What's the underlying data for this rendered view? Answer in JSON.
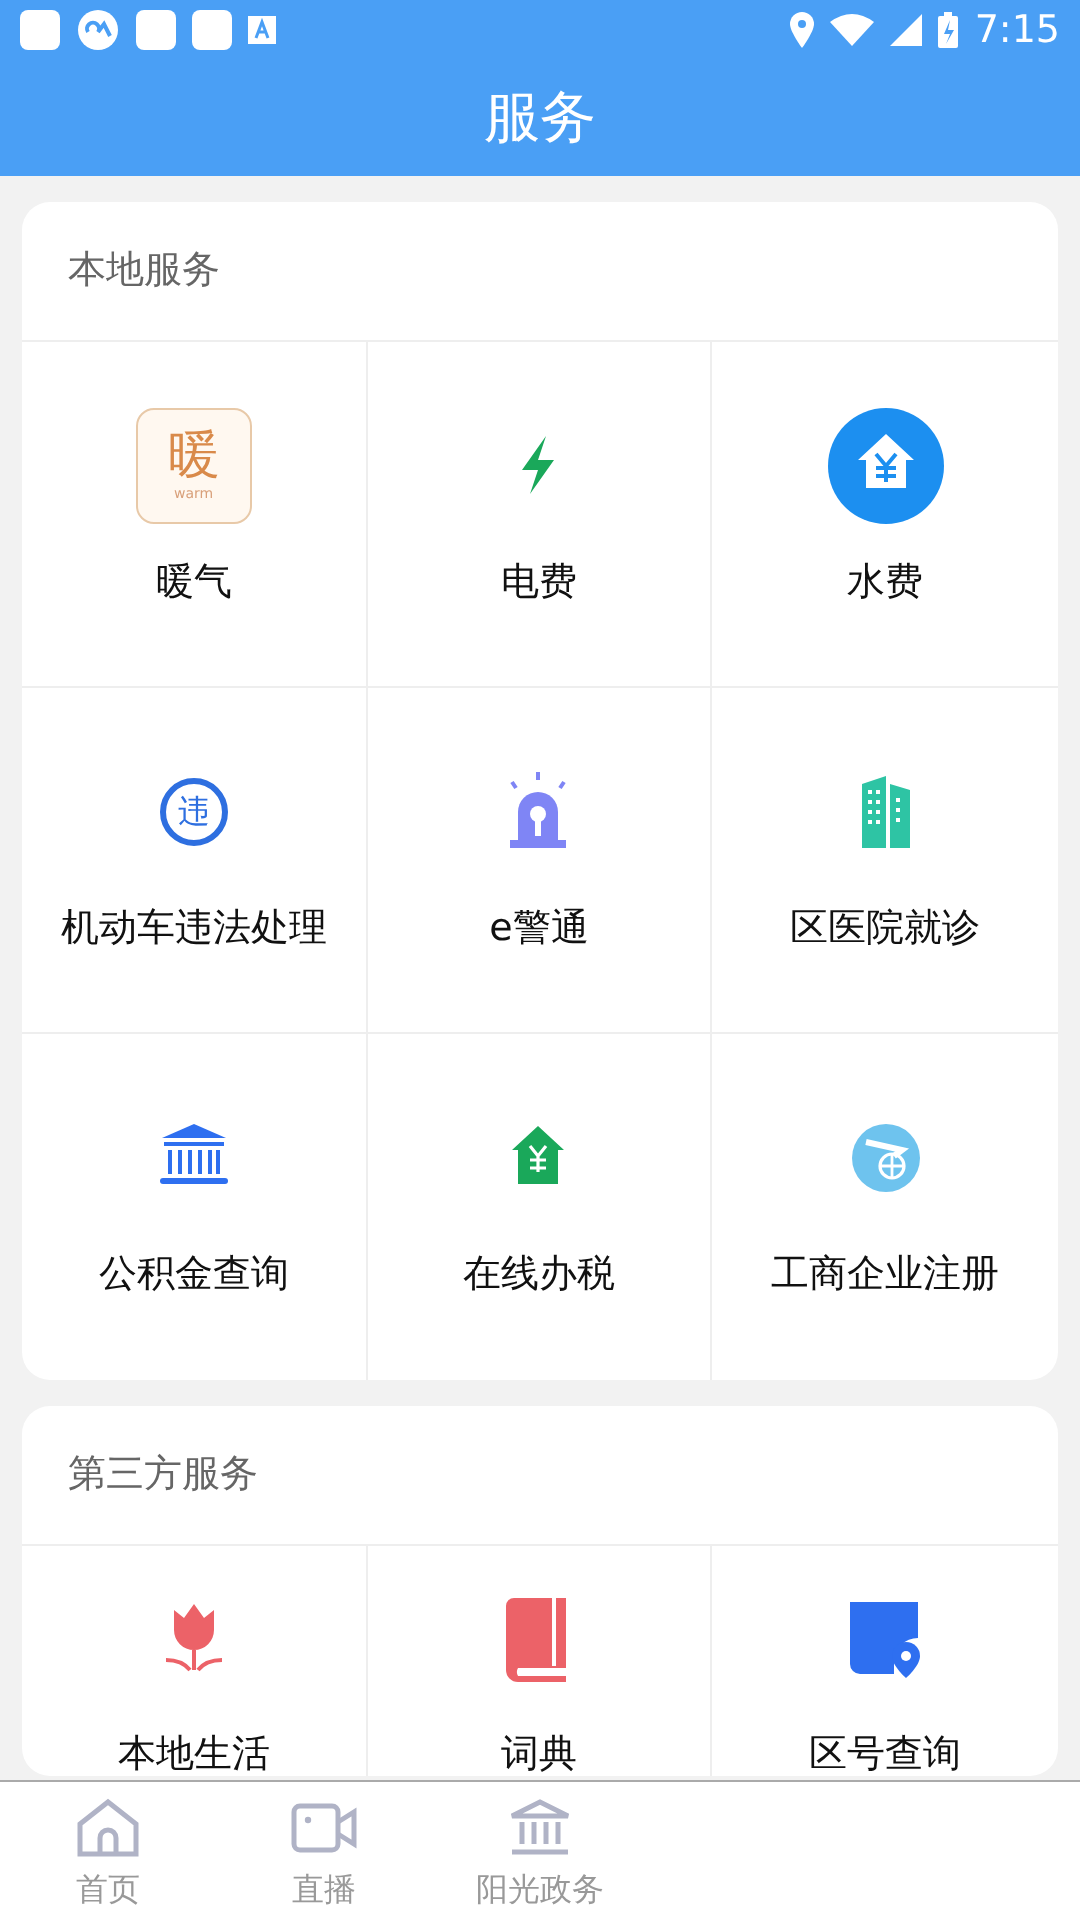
{
  "status_bar": {
    "time": "7:15"
  },
  "header": {
    "title": "服务"
  },
  "sections": [
    {
      "title": "本地服务",
      "items": [
        {
          "label": "暖气",
          "icon_text": "暖",
          "icon_subtext": "warm"
        },
        {
          "label": "电费"
        },
        {
          "label": "水费"
        },
        {
          "label": "机动车违法处理",
          "icon_text": "违"
        },
        {
          "label": "e警通"
        },
        {
          "label": "区医院就诊"
        },
        {
          "label": "公积金查询"
        },
        {
          "label": "在线办税"
        },
        {
          "label": "工商企业注册"
        }
      ]
    },
    {
      "title": "第三方服务",
      "items": [
        {
          "label": "本地生活"
        },
        {
          "label": "词典"
        },
        {
          "label": "区号查询"
        }
      ]
    }
  ],
  "bottom_nav": [
    {
      "label": "首页",
      "selected": false
    },
    {
      "label": "直播",
      "selected": false
    },
    {
      "label": "阳光政务",
      "selected": false
    }
  ]
}
